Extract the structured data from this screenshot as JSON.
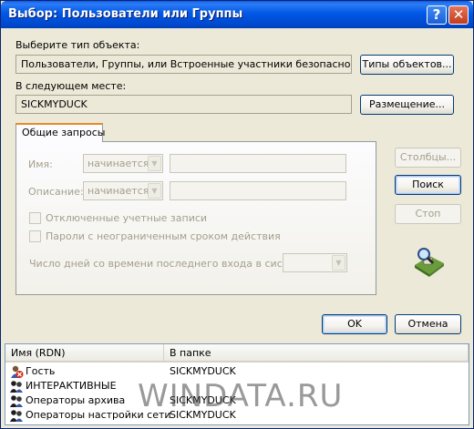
{
  "window": {
    "title": "Выбор: Пользователи или Группы"
  },
  "object_type": {
    "label": "Выберите тип объекта:",
    "value": "Пользователи, Группы, или Встроенные участники безопасности",
    "button": "Типы объектов..."
  },
  "location": {
    "label": "В следующем месте:",
    "value": "SICKMYDUCK",
    "button": "Размещение..."
  },
  "tab": {
    "label": "Общие запросы",
    "name_label": "Имя:",
    "name_combo": "начинается",
    "desc_label": "Описание:",
    "desc_combo": "начинается",
    "disabled_accounts": "Отключенные учетные записи",
    "nonexpiring_passwords": "Пароли с неограниченным сроком действия",
    "days_label": "Число дней со времени последнего входа в систему:"
  },
  "side_buttons": {
    "columns": "Столбцы...",
    "search": "Поиск",
    "stop": "Стоп"
  },
  "footer": {
    "ok": "OK",
    "cancel": "Отмена"
  },
  "results": {
    "columns": [
      "Имя (RDN)",
      "В папке"
    ],
    "rows": [
      {
        "name": "Гость",
        "folder": "SICKMYDUCK",
        "icon": "disabled-user-icon"
      },
      {
        "name": "ИНТЕРАКТИВНЫЕ",
        "folder": "",
        "icon": "group-icon"
      },
      {
        "name": "Операторы архива",
        "folder": "SICKMYDUCK",
        "icon": "group-icon"
      },
      {
        "name": "Операторы настройки сети",
        "folder": "SICKMYDUCK",
        "icon": "group-icon"
      }
    ]
  },
  "watermark": "WINDATA.RU"
}
